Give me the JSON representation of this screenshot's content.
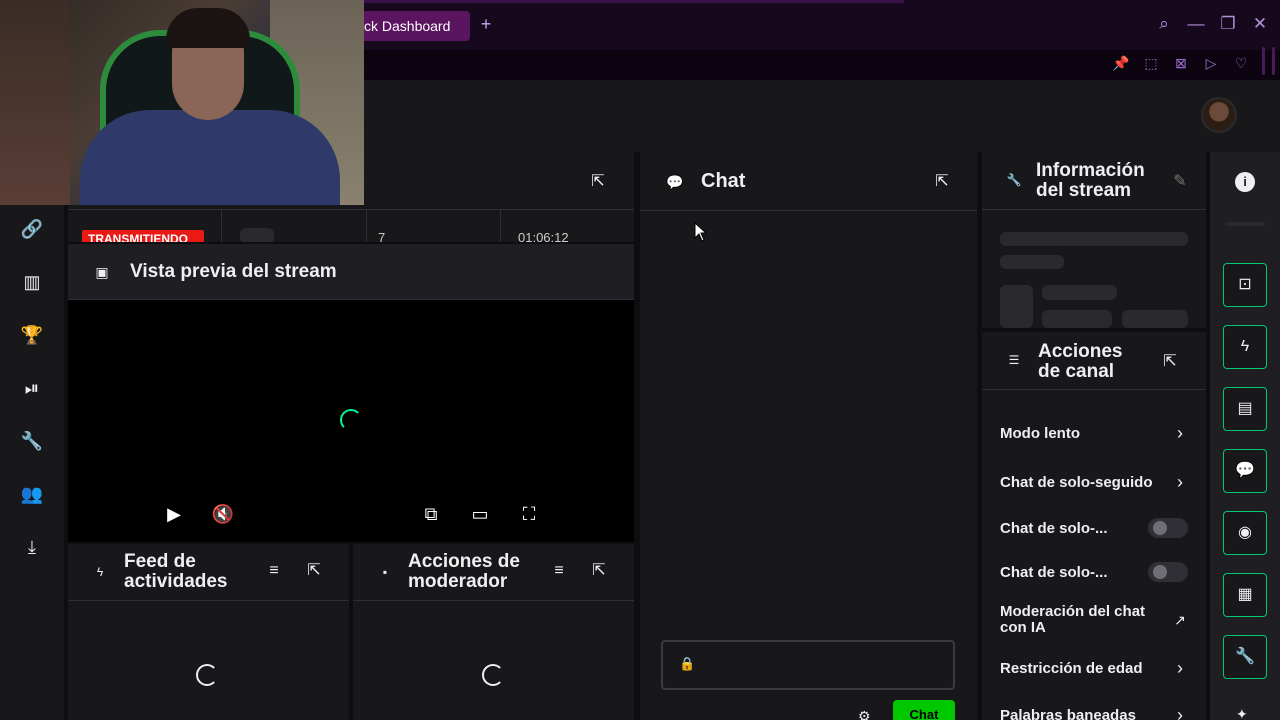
{
  "browser": {
    "tab_label": "ck Dashboard",
    "tab_add": "+",
    "controls": {
      "search": "⌕",
      "minimize": "—",
      "restore": "❐",
      "close": "✕"
    },
    "extensions": [
      "pin-icon",
      "crop-icon",
      "block-icon",
      "send-icon",
      "heart-icon"
    ]
  },
  "left_nav": {
    "items": [
      "link-icon",
      "chart-icon",
      "trophy-icon",
      "video-icon",
      "wrench-icon",
      "users-icon",
      "download-icon"
    ]
  },
  "stats_row": {
    "live_badge": "TRANSMITIENDO",
    "viewers": "7",
    "time": "01:06:12"
  },
  "preview": {
    "title": "Vista previa del stream"
  },
  "activity_feed": {
    "title_line1": "Feed de",
    "title_line2": "actividades"
  },
  "mod_actions": {
    "title_line1": "Acciones de",
    "title_line2": "moderador"
  },
  "chat": {
    "title": "Chat",
    "send_label": "Chat"
  },
  "stream_info": {
    "title_line1": "Información",
    "title_line2": "del stream"
  },
  "channel_actions": {
    "title_line1": "Acciones",
    "title_line2": "de canal",
    "items": [
      {
        "label": "Modo lento",
        "type": "chevron"
      },
      {
        "label": "Chat de solo-seguido",
        "type": "chevron"
      },
      {
        "label": "Chat de solo-...",
        "type": "toggle"
      },
      {
        "label": "Chat de solo-...",
        "type": "toggle"
      },
      {
        "label_line1": "Moderación del chat",
        "label_line2": "con IA",
        "type": "external"
      },
      {
        "label": "Restricción de edad",
        "type": "chevron"
      },
      {
        "label": "Palabras baneadas",
        "type": "chevron"
      }
    ]
  },
  "right_bar": {
    "items": [
      "info-icon",
      "screenshot-icon",
      "lightning-icon",
      "document-icon",
      "chat-icon",
      "broadcast-icon",
      "clip-icon",
      "wrench-icon",
      "more-icon"
    ]
  }
}
